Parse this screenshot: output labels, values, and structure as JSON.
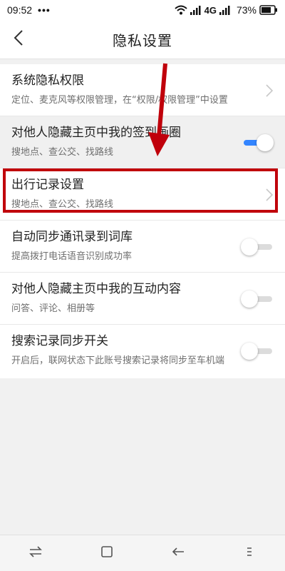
{
  "status_bar": {
    "time": "09:52",
    "dots": "•••",
    "network": "4G",
    "battery": "73%"
  },
  "nav": {
    "title": "隐私设置"
  },
  "rows": [
    {
      "title": "系统隐私权限",
      "subtitle": "定位、麦克风等权限管理，在“权限/权限管理”中设置",
      "control": "chevron"
    },
    {
      "title": "对他人隐藏主页中我的签到画圈",
      "subtitle": "搜地点、查公交、找路线",
      "control": "toggle",
      "on": true
    },
    {
      "title": "出行记录设置",
      "subtitle": "搜地点、查公交、找路线",
      "control": "chevron",
      "highlighted": true
    },
    {
      "title": "自动同步通讯录到词库",
      "subtitle": "提高拨打电话语音识别成功率",
      "control": "toggle",
      "on": false
    },
    {
      "title": "对他人隐藏主页中我的互动内容",
      "subtitle": "问答、评论、相册等",
      "control": "toggle",
      "on": false
    },
    {
      "title": "搜索记录同步开关",
      "subtitle": "开启后，联网状态下此账号搜索记录将同步至车机端",
      "control": "toggle",
      "on": false
    }
  ],
  "colors": {
    "accent": "#3385ff",
    "annotation": "#c0000b"
  },
  "icons": {
    "back": "chevron-left-icon",
    "switch": "swap-icon",
    "home": "square-icon",
    "back_nav": "back-icon",
    "menu": "menu-icon"
  }
}
